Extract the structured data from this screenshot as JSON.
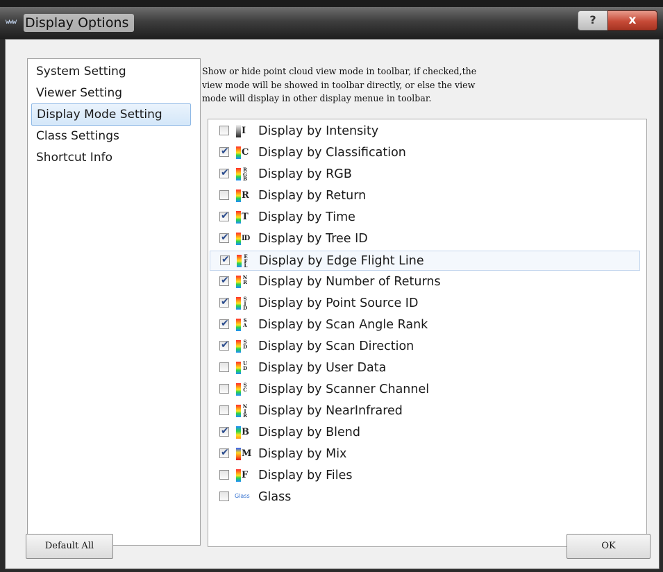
{
  "window": {
    "title": "Display Options",
    "app_icon_text": "www",
    "help_label": "?",
    "close_label": "x"
  },
  "nav": {
    "items": [
      {
        "label": "System Setting",
        "selected": false
      },
      {
        "label": "Viewer Setting",
        "selected": false
      },
      {
        "label": "Display Mode Setting",
        "selected": true
      },
      {
        "label": "Class Settings",
        "selected": false
      },
      {
        "label": "Shortcut Info",
        "selected": false
      }
    ]
  },
  "description": "Show or hide point cloud view mode in toolbar, if checked,the\nview mode will be showed in toolbar directly, or else the view\nmode will display in other display menue in toolbar.",
  "modes": [
    {
      "label": "Display by Intensity",
      "checked": false,
      "icon": "intensity-icon",
      "glyph": "I",
      "bar": "gray"
    },
    {
      "label": "Display by Classification",
      "checked": true,
      "icon": "classification-icon",
      "glyph": "C",
      "bar": "rainbow"
    },
    {
      "label": "Display by RGB",
      "checked": true,
      "icon": "rgb-icon",
      "glyph": "R G B",
      "bar": "rainbow",
      "stack": true
    },
    {
      "label": "Display by Return",
      "checked": false,
      "icon": "return-icon",
      "glyph": "R",
      "bar": "rainbow"
    },
    {
      "label": "Display by Time",
      "checked": true,
      "icon": "time-icon",
      "glyph": "T",
      "bar": "rainbow"
    },
    {
      "label": "Display by Tree ID",
      "checked": true,
      "icon": "tree-id-icon",
      "glyph": "ID",
      "bar": "rainbow",
      "wide": true
    },
    {
      "label": "Display by Edge Flight Line",
      "checked": true,
      "icon": "edge-flight-line-icon",
      "glyph": "E F L",
      "bar": "rainbow",
      "stack": true,
      "highlight": true
    },
    {
      "label": "Display by Number of Returns",
      "checked": true,
      "icon": "number-of-returns-icon",
      "glyph": "N R",
      "bar": "rainbow",
      "stack": true
    },
    {
      "label": "Display by Point Source ID",
      "checked": true,
      "icon": "point-source-id-icon",
      "glyph": "S I D",
      "bar": "rainbow",
      "stack": true
    },
    {
      "label": "Display by Scan Angle Rank",
      "checked": true,
      "icon": "scan-angle-rank-icon",
      "glyph": "S A",
      "bar": "rainbow",
      "stack": true
    },
    {
      "label": "Display by Scan Direction",
      "checked": true,
      "icon": "scan-direction-icon",
      "glyph": "S D",
      "bar": "rainbow",
      "stack": true
    },
    {
      "label": "Display by User Data",
      "checked": false,
      "icon": "user-data-icon",
      "glyph": "U D",
      "bar": "rainbow",
      "stack": true
    },
    {
      "label": "Display by Scanner Channel",
      "checked": false,
      "icon": "scanner-channel-icon",
      "glyph": "S C",
      "bar": "rainbow",
      "stack": true
    },
    {
      "label": "Display by NearInfrared",
      "checked": false,
      "icon": "near-infrared-icon",
      "glyph": "N I R",
      "bar": "rainbow",
      "stack": true
    },
    {
      "label": "Display by Blend",
      "checked": true,
      "icon": "blend-icon",
      "glyph": "B",
      "bar": "blend"
    },
    {
      "label": "Display by Mix",
      "checked": true,
      "icon": "mix-icon",
      "glyph": "M",
      "bar": "mix"
    },
    {
      "label": "Display by Files",
      "checked": false,
      "icon": "files-icon",
      "glyph": "F",
      "bar": "rainbow"
    },
    {
      "label": "Glass",
      "checked": false,
      "icon": "glass-icon",
      "glyph": "Glass",
      "bar": "none"
    }
  ],
  "buttons": {
    "default_all": "Default All",
    "ok": "OK"
  },
  "colors": {
    "selection_bg": "#d4e7f9",
    "selection_border": "#8fb9e6",
    "check": "#2c4d8e",
    "close_button": "#c64a37"
  }
}
